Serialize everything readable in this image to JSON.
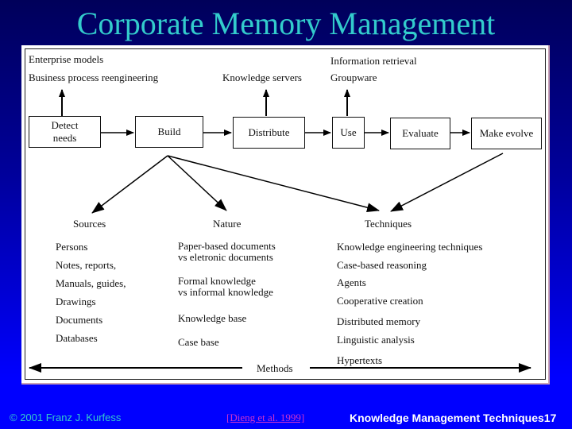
{
  "slide": {
    "title": "Corporate Memory Management",
    "footer": {
      "copyright": "© 2001 Franz J. Kurfess",
      "citation": "[Dieng et al. 1999]",
      "course_label": "Knowledge Management Techniques",
      "page_number": "17"
    }
  },
  "diagram": {
    "top_labels": {
      "detect": [
        "Enterprise models",
        "Business process reengineering"
      ],
      "distribute": "Knowledge servers",
      "use": [
        "Information retrieval",
        "Groupware"
      ]
    },
    "process_boxes": [
      {
        "id": "detect",
        "label_lines": [
          "Detect",
          "needs"
        ]
      },
      {
        "id": "build",
        "label_lines": [
          "Build"
        ]
      },
      {
        "id": "distribute",
        "label_lines": [
          "Distribute"
        ]
      },
      {
        "id": "use",
        "label_lines": [
          "Use"
        ]
      },
      {
        "id": "evaluate",
        "label_lines": [
          "Evaluate"
        ]
      },
      {
        "id": "make-evolve",
        "label_lines": [
          "Make evolve"
        ]
      }
    ],
    "categories": {
      "sources": {
        "heading": "Sources",
        "items": [
          "Persons",
          "Notes, reports,",
          "Manuals, guides,",
          "Drawings",
          "Documents",
          "Databases"
        ]
      },
      "nature": {
        "heading": "Nature",
        "items": [
          [
            "Paper-based documents",
            "vs eletronic documents"
          ],
          [
            "Formal knowledge",
            "vs informal knowledge"
          ],
          [
            "Knowledge base"
          ],
          [
            "Case base"
          ]
        ]
      },
      "techniques": {
        "heading": "Techniques",
        "items": [
          "Knowledge engineering techniques",
          "Case-based reasoning",
          "Agents",
          "Cooperative creation",
          "Distributed memory",
          "Linguistic analysis",
          "Hypertexts"
        ]
      }
    },
    "methods_label": "Methods"
  }
}
